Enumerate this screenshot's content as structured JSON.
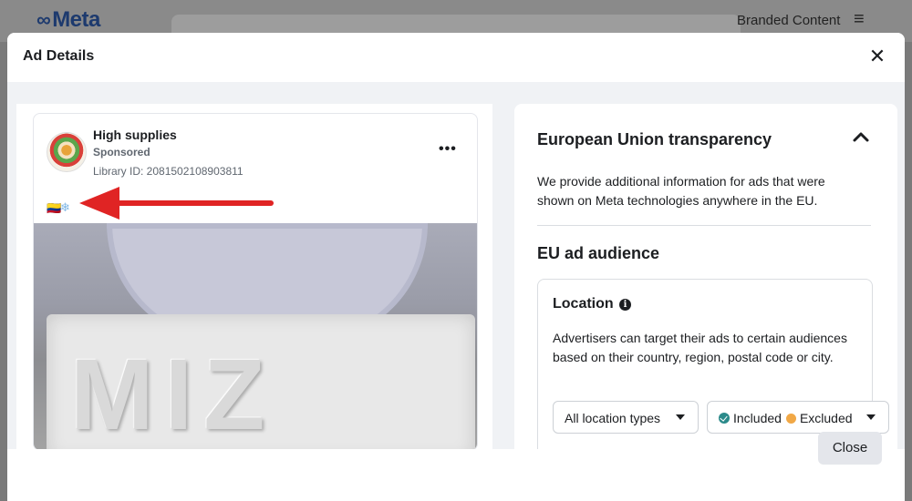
{
  "background": {
    "logo_text": "Meta",
    "logo_symbol": "∞",
    "branded_content_link": "Branded Content",
    "menu_icon": "≡"
  },
  "modal": {
    "title": "Ad Details",
    "close_icon": "✕",
    "footer_close_label": "Close"
  },
  "ad": {
    "advertiser_name": "High supplies",
    "sponsored_label": "Sponsored",
    "library_id": "Library ID: 2081502108903811",
    "more_icon": "•••",
    "flag_emoji": "🇨🇴",
    "snowflake_emoji": "❄",
    "image_text": "MIZ",
    "arrow_color": "#e02424"
  },
  "eu_panel": {
    "title": "European Union transparency",
    "description": "We provide additional information for ads that were shown on Meta technologies anywhere in the EU.",
    "audience_title": "EU ad audience",
    "location": {
      "title": "Location",
      "info_icon": "i",
      "description": "Advertisers can target their ads to certain audiences based on their country, region, postal code or city.",
      "location_type_dropdown": "All location types",
      "included_label": "Included",
      "excluded_label": "Excluded"
    }
  },
  "colors": {
    "included_dot": "#2b8a8a",
    "excluded_dot": "#f1a846"
  }
}
